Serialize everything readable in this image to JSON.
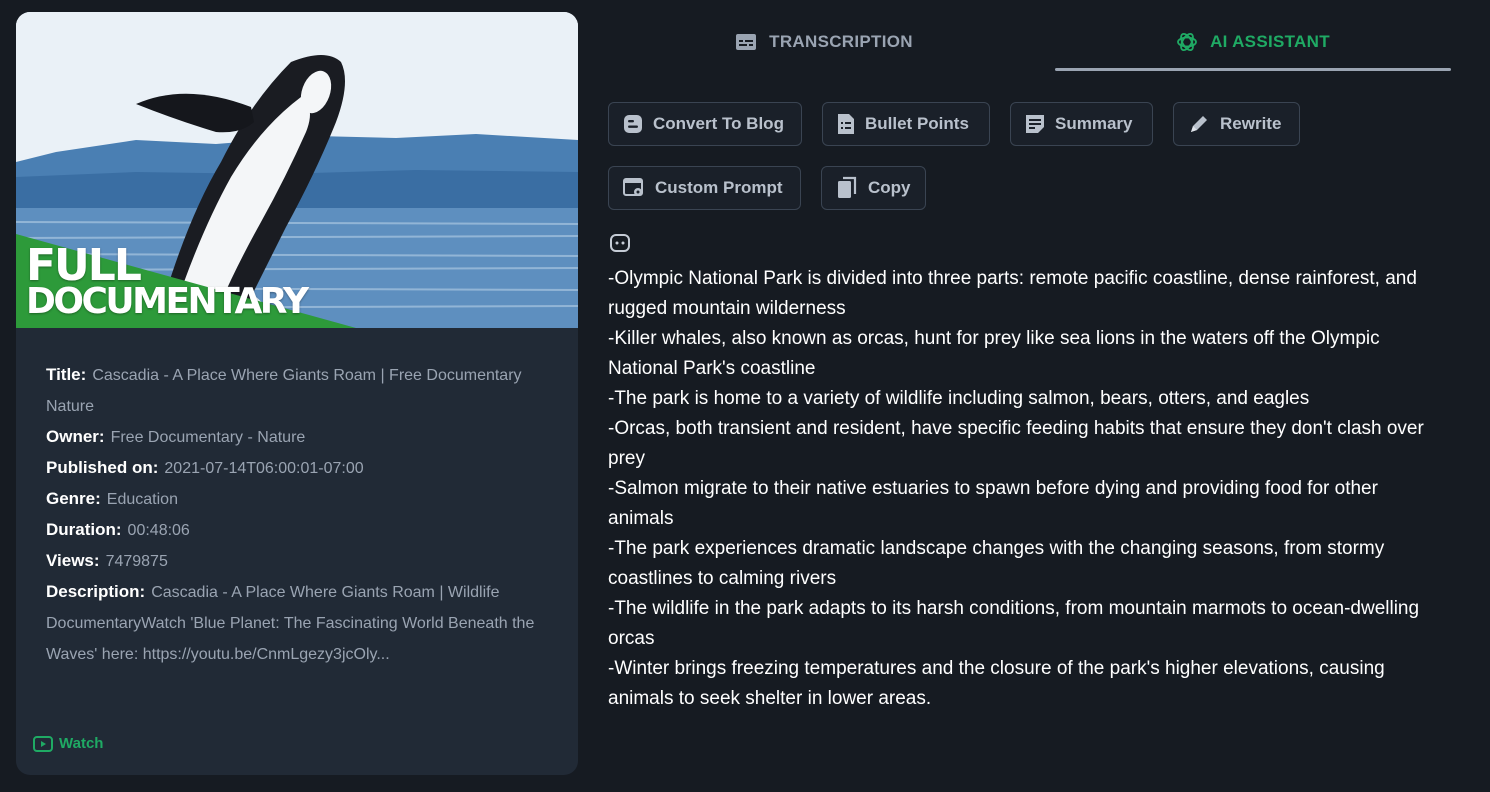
{
  "video": {
    "thumbnail_text_line1": "FULL",
    "thumbnail_text_line2": "DOCUMENTARY",
    "fields": [
      {
        "label": "Title:",
        "value": "Cascadia - A Place Where Giants Roam | Free Documentary Nature"
      },
      {
        "label": "Owner:",
        "value": "Free Documentary - Nature"
      },
      {
        "label": "Published on:",
        "value": "2021-07-14T06:00:01-07:00"
      },
      {
        "label": "Genre:",
        "value": "Education"
      },
      {
        "label": "Duration:",
        "value": "00:48:06"
      },
      {
        "label": "Views:",
        "value": "7479875"
      },
      {
        "label": "Description:",
        "value": "Cascadia - A Place Where Giants Roam | Wildlife DocumentaryWatch 'Blue Planet: The Fascinating World Beneath the Waves' here: https://youtu.be/CnmLgezy3jcOly..."
      }
    ],
    "watch_label": "Watch",
    "watch_icon": "play-icon"
  },
  "tabs": [
    {
      "label": "TRANSCRIPTION",
      "icon": "subtitles-icon",
      "active": false
    },
    {
      "label": "AI ASSISTANT",
      "icon": "openai-icon",
      "active": true
    }
  ],
  "actions": [
    {
      "label": "Convert To Blog",
      "icon": "blogger-icon"
    },
    {
      "label": "Bullet Points",
      "icon": "document-list-icon"
    },
    {
      "label": "Summary",
      "icon": "note-icon"
    },
    {
      "label": "Rewrite",
      "icon": "pen-icon"
    },
    {
      "label": "Custom Prompt",
      "icon": "settings-window-icon"
    },
    {
      "label": "Copy",
      "icon": "copy-icon"
    }
  ],
  "assistant": {
    "icon": "bot-icon",
    "lines": [
      "-Olympic National Park is divided into three parts: remote pacific coastline, dense rainforest, and rugged mountain wilderness",
      "-Killer whales, also known as orcas, hunt for prey like sea lions in the waters off the Olympic National Park's coastline",
      "-The park is home to a variety of wildlife including salmon, bears, otters, and eagles",
      "-Orcas, both transient and resident, have specific feeding habits that ensure they don't clash over prey",
      "-Salmon migrate to their native estuaries to spawn before dying and providing food for other animals",
      "-The park experiences dramatic landscape changes with the changing seasons, from stormy coastlines to calming rivers",
      "-The wildlife in the park adapts to its harsh conditions, from mountain marmots to ocean-dwelling orcas",
      "-Winter brings freezing temperatures and the closure of the park's higher elevations, causing animals to seek shelter in lower areas."
    ]
  },
  "colors": {
    "background": "#161b22",
    "card": "#212a36",
    "accent": "#1faa64",
    "muted": "#9aa4b2"
  }
}
